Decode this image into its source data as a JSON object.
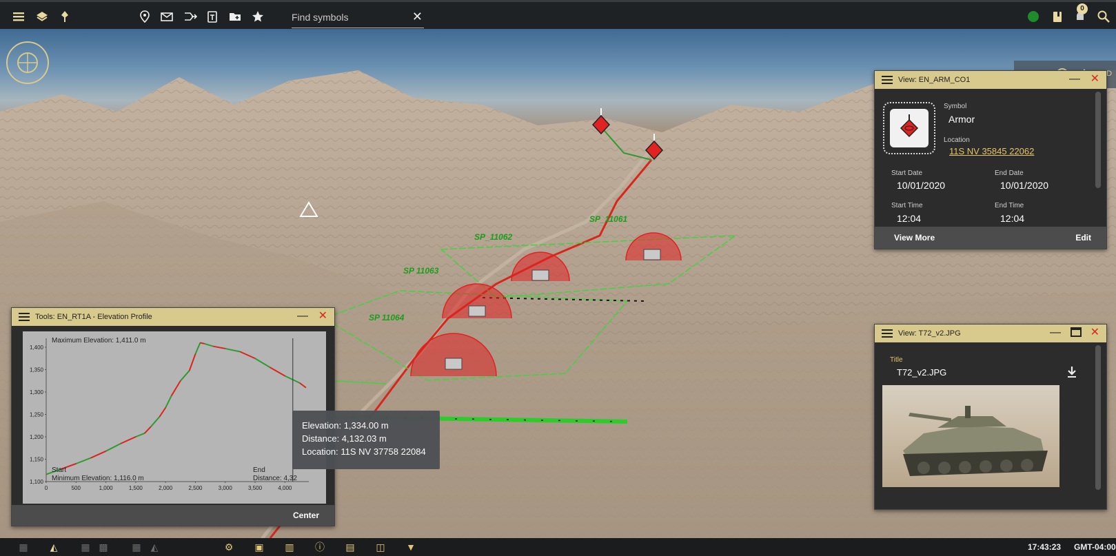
{
  "topbar": {
    "icons": [
      "menu-icon",
      "layers-icon",
      "pin-icon",
      "location-pin-icon",
      "message-icon",
      "route-icon",
      "template-icon",
      "folder-add-icon",
      "star-icon"
    ],
    "search_placeholder": "Find symbols",
    "notification_count": "0",
    "status_color": "#1f8b2a"
  },
  "map": {
    "labels": {
      "sp1": "SP_11061",
      "sp2": "SP_11062",
      "sp3": "SP 11063",
      "sp4": "SP 11064"
    },
    "view_mode": "2D"
  },
  "symbol_panel": {
    "title": "View: EN_ARM_CO1",
    "symbol_label": "Symbol",
    "symbol_value": "Armor",
    "location_label": "Location",
    "location_value": "11S NV 35845 22062",
    "start_date_label": "Start Date",
    "start_date": "10/01/2020",
    "end_date_label": "End Date",
    "end_date": "10/01/2020",
    "start_time_label": "Start Time",
    "start_time": "12:04",
    "end_time_label": "End Time",
    "end_time": "12:04",
    "view_more": "View More",
    "edit": "Edit"
  },
  "image_panel": {
    "title": "View: T72_v2.JPG",
    "title_label": "Title",
    "title_value": "T72_v2.JPG"
  },
  "elevation_panel": {
    "title": "Tools: EN_RT1A - Elevation Profile",
    "max_label": "Maximum Elevation: 1,411.0 m",
    "min_label": "Minimum Elevation: 1,116.0 m",
    "start_label": "Start",
    "end_label": "End",
    "distance_label": "Distance: 4,32",
    "center_button": "Center"
  },
  "tooltip": {
    "elevation": "Elevation: 1,334.00 m",
    "distance": "Distance:  4,132.03 m",
    "location": "Location:  11S NV 37758 22084"
  },
  "chart_data": {
    "type": "line",
    "x": [
      0,
      250,
      500,
      750,
      1000,
      1250,
      1500,
      1650,
      1750,
      1900,
      2000,
      2100,
      2250,
      2400,
      2500,
      2580,
      2650,
      2800,
      3000,
      3250,
      3500,
      3750,
      4000,
      4250,
      4350
    ],
    "y": [
      1116,
      1128,
      1140,
      1153,
      1168,
      1185,
      1200,
      1208,
      1222,
      1245,
      1265,
      1292,
      1325,
      1348,
      1385,
      1410,
      1408,
      1402,
      1397,
      1390,
      1375,
      1355,
      1336,
      1320,
      1310
    ],
    "xticks": [
      "0",
      "500",
      "1,000",
      "1,500",
      "2,000",
      "2,500",
      "3,000",
      "3,500",
      "4,000"
    ],
    "yticks": [
      "1,100",
      "1,150",
      "1,200",
      "1,250",
      "1,300",
      "1,350",
      "1,400"
    ],
    "xlim": [
      0,
      4400
    ],
    "ylim": [
      1100,
      1420
    ],
    "cursor_x": 4132,
    "colors": [
      "#2f9a30",
      "#d8261c"
    ]
  },
  "bottombar": {
    "time": "17:43:23",
    "timezone": "GMT-04:00"
  }
}
